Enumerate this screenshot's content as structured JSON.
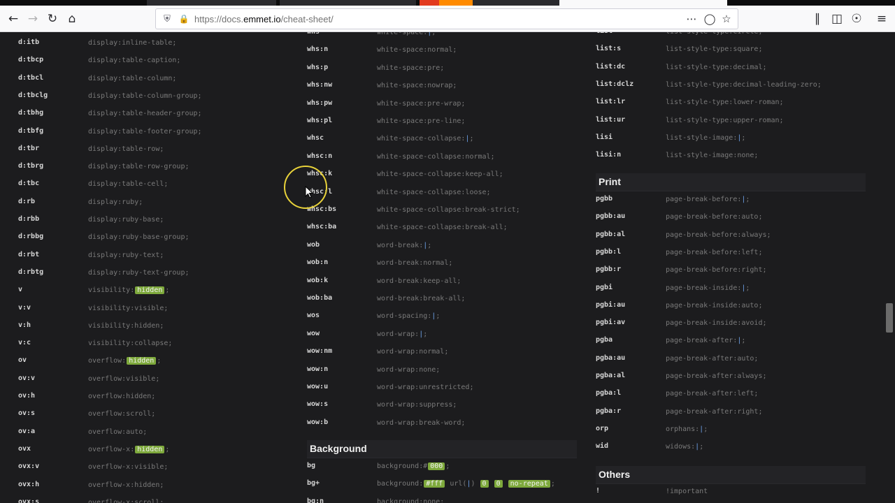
{
  "browser": {
    "url_prefix": "https://docs.",
    "url_domain": "emmet.io",
    "url_path": "/cheat-sheet/",
    "icons": [
      "back-icon",
      "forward-icon",
      "reload-icon",
      "home-icon",
      "shield-icon",
      "lock-icon",
      "more-icon",
      "pocket-icon",
      "bookmark-star-icon",
      "library-icon",
      "sidebar-icon",
      "account-icon",
      "menu-icon"
    ]
  },
  "colors": {
    "page_bg": "#1c1c1e",
    "highlight": "#7ea93c",
    "cursor_ring": "#e8d23a"
  },
  "col1": [
    {
      "abbr": "d:itb",
      "snippet": [
        {
          "t": "display:inline-table;"
        }
      ]
    },
    {
      "abbr": "d:tbcp",
      "snippet": [
        {
          "t": "display:table-caption;"
        }
      ]
    },
    {
      "abbr": "d:tbcl",
      "snippet": [
        {
          "t": "display:table-column;"
        }
      ]
    },
    {
      "abbr": "d:tbclg",
      "snippet": [
        {
          "t": "display:table-column-group;"
        }
      ]
    },
    {
      "abbr": "d:tbhg",
      "snippet": [
        {
          "t": "display:table-header-group;"
        }
      ]
    },
    {
      "abbr": "d:tbfg",
      "snippet": [
        {
          "t": "display:table-footer-group;"
        }
      ]
    },
    {
      "abbr": "d:tbr",
      "snippet": [
        {
          "t": "display:table-row;"
        }
      ]
    },
    {
      "abbr": "d:tbrg",
      "snippet": [
        {
          "t": "display:table-row-group;"
        }
      ]
    },
    {
      "abbr": "d:tbc",
      "snippet": [
        {
          "t": "display:table-cell;"
        }
      ]
    },
    {
      "abbr": "d:rb",
      "snippet": [
        {
          "t": "display:ruby;"
        }
      ]
    },
    {
      "abbr": "d:rbb",
      "snippet": [
        {
          "t": "display:ruby-base;"
        }
      ]
    },
    {
      "abbr": "d:rbbg",
      "snippet": [
        {
          "t": "display:ruby-base-group;"
        }
      ]
    },
    {
      "abbr": "d:rbt",
      "snippet": [
        {
          "t": "display:ruby-text;"
        }
      ]
    },
    {
      "abbr": "d:rbtg",
      "snippet": [
        {
          "t": "display:ruby-text-group;"
        }
      ]
    },
    {
      "abbr": "v",
      "snippet": [
        {
          "t": "visibility:"
        },
        {
          "t": "hidden",
          "hl": true
        },
        {
          "t": ";"
        }
      ]
    },
    {
      "abbr": "v:v",
      "snippet": [
        {
          "t": "visibility:visible;"
        }
      ]
    },
    {
      "abbr": "v:h",
      "snippet": [
        {
          "t": "visibility:hidden;"
        }
      ]
    },
    {
      "abbr": "v:c",
      "snippet": [
        {
          "t": "visibility:collapse;"
        }
      ]
    },
    {
      "abbr": "ov",
      "snippet": [
        {
          "t": "overflow:"
        },
        {
          "t": "hidden",
          "hl": true
        },
        {
          "t": ";"
        }
      ]
    },
    {
      "abbr": "ov:v",
      "snippet": [
        {
          "t": "overflow:visible;"
        }
      ]
    },
    {
      "abbr": "ov:h",
      "snippet": [
        {
          "t": "overflow:hidden;"
        }
      ]
    },
    {
      "abbr": "ov:s",
      "snippet": [
        {
          "t": "overflow:scroll;"
        }
      ]
    },
    {
      "abbr": "ov:a",
      "snippet": [
        {
          "t": "overflow:auto;"
        }
      ]
    },
    {
      "abbr": "ovx",
      "snippet": [
        {
          "t": "overflow-x:"
        },
        {
          "t": "hidden",
          "hl": true
        },
        {
          "t": ";"
        }
      ]
    },
    {
      "abbr": "ovx:v",
      "snippet": [
        {
          "t": "overflow-x:visible;"
        }
      ]
    },
    {
      "abbr": "ovx:h",
      "snippet": [
        {
          "t": "overflow-x:hidden;"
        }
      ]
    },
    {
      "abbr": "ovx:s",
      "snippet": [
        {
          "t": "overflow-x:scroll;"
        }
      ]
    }
  ],
  "col2": [
    {
      "abbr": "whs",
      "snippet": [
        {
          "t": "white-space:"
        },
        {
          "t": "|",
          "cur": true
        },
        {
          "t": ";"
        }
      ]
    },
    {
      "abbr": "whs:n",
      "snippet": [
        {
          "t": "white-space:normal;"
        }
      ]
    },
    {
      "abbr": "whs:p",
      "snippet": [
        {
          "t": "white-space:pre;"
        }
      ]
    },
    {
      "abbr": "whs:nw",
      "snippet": [
        {
          "t": "white-space:nowrap;"
        }
      ]
    },
    {
      "abbr": "whs:pw",
      "snippet": [
        {
          "t": "white-space:pre-wrap;"
        }
      ]
    },
    {
      "abbr": "whs:pl",
      "snippet": [
        {
          "t": "white-space:pre-line;"
        }
      ]
    },
    {
      "abbr": "whsc",
      "snippet": [
        {
          "t": "white-space-collapse:"
        },
        {
          "t": "|",
          "cur": true
        },
        {
          "t": ";"
        }
      ]
    },
    {
      "abbr": "whsc:n",
      "snippet": [
        {
          "t": "white-space-collapse:normal;"
        }
      ]
    },
    {
      "abbr": "whsc:k",
      "snippet": [
        {
          "t": "white-space-collapse:keep-all;"
        }
      ]
    },
    {
      "abbr": "whsc:l",
      "snippet": [
        {
          "t": "white-space-collapse:loose;"
        }
      ]
    },
    {
      "abbr": "whsc:bs",
      "snippet": [
        {
          "t": "white-space-collapse:break-strict;"
        }
      ]
    },
    {
      "abbr": "whsc:ba",
      "snippet": [
        {
          "t": "white-space-collapse:break-all;"
        }
      ]
    },
    {
      "abbr": "wob",
      "snippet": [
        {
          "t": "word-break:"
        },
        {
          "t": "|",
          "cur": true
        },
        {
          "t": ";"
        }
      ]
    },
    {
      "abbr": "wob:n",
      "snippet": [
        {
          "t": "word-break:normal;"
        }
      ]
    },
    {
      "abbr": "wob:k",
      "snippet": [
        {
          "t": "word-break:keep-all;"
        }
      ]
    },
    {
      "abbr": "wob:ba",
      "snippet": [
        {
          "t": "word-break:break-all;"
        }
      ]
    },
    {
      "abbr": "wos",
      "snippet": [
        {
          "t": "word-spacing:"
        },
        {
          "t": "|",
          "cur": true
        },
        {
          "t": ";"
        }
      ]
    },
    {
      "abbr": "wow",
      "snippet": [
        {
          "t": "word-wrap:"
        },
        {
          "t": "|",
          "cur": true
        },
        {
          "t": ";"
        }
      ]
    },
    {
      "abbr": "wow:nm",
      "snippet": [
        {
          "t": "word-wrap:normal;"
        }
      ]
    },
    {
      "abbr": "wow:n",
      "snippet": [
        {
          "t": "word-wrap:none;"
        }
      ]
    },
    {
      "abbr": "wow:u",
      "snippet": [
        {
          "t": "word-wrap:unrestricted;"
        }
      ]
    },
    {
      "abbr": "wow:s",
      "snippet": [
        {
          "t": "word-wrap:suppress;"
        }
      ]
    },
    {
      "abbr": "wow:b",
      "snippet": [
        {
          "t": "word-wrap:break-word;"
        }
      ]
    }
  ],
  "background": {
    "title": "Background",
    "rows": [
      {
        "abbr": "bg",
        "snippet": [
          {
            "t": "background:#"
          },
          {
            "t": "000",
            "hl": true
          },
          {
            "t": ";"
          }
        ]
      },
      {
        "abbr": "bg+",
        "snippet": [
          {
            "t": "background:"
          },
          {
            "t": "#fff",
            "hl": true
          },
          {
            "t": " url("
          },
          {
            "t": "|",
            "cur": true
          },
          {
            "t": ") "
          },
          {
            "t": "0",
            "hl": true
          },
          {
            "t": " "
          },
          {
            "t": "0",
            "hl": true
          },
          {
            "t": " "
          },
          {
            "t": "no-repeat",
            "hl": true
          },
          {
            "t": ";"
          }
        ]
      },
      {
        "abbr": "bg:n",
        "snippet": [
          {
            "t": "background:none;"
          }
        ]
      }
    ]
  },
  "col3": [
    {
      "abbr": "list",
      "snippet": [
        {
          "t": "list-style-type:circle;"
        }
      ]
    },
    {
      "abbr": "list:s",
      "snippet": [
        {
          "t": "list-style-type:square;"
        }
      ]
    },
    {
      "abbr": "list:dc",
      "snippet": [
        {
          "t": "list-style-type:decimal;"
        }
      ]
    },
    {
      "abbr": "list:dclz",
      "snippet": [
        {
          "t": "list-style-type:decimal-leading-zero;"
        }
      ]
    },
    {
      "abbr": "list:lr",
      "snippet": [
        {
          "t": "list-style-type:lower-roman;"
        }
      ]
    },
    {
      "abbr": "list:ur",
      "snippet": [
        {
          "t": "list-style-type:upper-roman;"
        }
      ]
    },
    {
      "abbr": "lisi",
      "snippet": [
        {
          "t": "list-style-image:"
        },
        {
          "t": "|",
          "cur": true
        },
        {
          "t": ";"
        }
      ]
    },
    {
      "abbr": "lisi:n",
      "snippet": [
        {
          "t": "list-style-image:none;"
        }
      ]
    }
  ],
  "print": {
    "title": "Print",
    "rows": [
      {
        "abbr": "pgbb",
        "snippet": [
          {
            "t": "page-break-before:"
          },
          {
            "t": "|",
            "cur": true
          },
          {
            "t": ";"
          }
        ]
      },
      {
        "abbr": "pgbb:au",
        "snippet": [
          {
            "t": "page-break-before:auto;"
          }
        ]
      },
      {
        "abbr": "pgbb:al",
        "snippet": [
          {
            "t": "page-break-before:always;"
          }
        ]
      },
      {
        "abbr": "pgbb:l",
        "snippet": [
          {
            "t": "page-break-before:left;"
          }
        ]
      },
      {
        "abbr": "pgbb:r",
        "snippet": [
          {
            "t": "page-break-before:right;"
          }
        ]
      },
      {
        "abbr": "pgbi",
        "snippet": [
          {
            "t": "page-break-inside:"
          },
          {
            "t": "|",
            "cur": true
          },
          {
            "t": ";"
          }
        ]
      },
      {
        "abbr": "pgbi:au",
        "snippet": [
          {
            "t": "page-break-inside:auto;"
          }
        ]
      },
      {
        "abbr": "pgbi:av",
        "snippet": [
          {
            "t": "page-break-inside:avoid;"
          }
        ]
      },
      {
        "abbr": "pgba",
        "snippet": [
          {
            "t": "page-break-after:"
          },
          {
            "t": "|",
            "cur": true
          },
          {
            "t": ";"
          }
        ]
      },
      {
        "abbr": "pgba:au",
        "snippet": [
          {
            "t": "page-break-after:auto;"
          }
        ]
      },
      {
        "abbr": "pgba:al",
        "snippet": [
          {
            "t": "page-break-after:always;"
          }
        ]
      },
      {
        "abbr": "pgba:l",
        "snippet": [
          {
            "t": "page-break-after:left;"
          }
        ]
      },
      {
        "abbr": "pgba:r",
        "snippet": [
          {
            "t": "page-break-after:right;"
          }
        ]
      },
      {
        "abbr": "orp",
        "snippet": [
          {
            "t": "orphans:"
          },
          {
            "t": "|",
            "cur": true
          },
          {
            "t": ";"
          }
        ]
      },
      {
        "abbr": "wid",
        "snippet": [
          {
            "t": "widows:"
          },
          {
            "t": "|",
            "cur": true
          },
          {
            "t": ";"
          }
        ]
      }
    ]
  },
  "others": {
    "title": "Others",
    "rows": [
      {
        "abbr": "!",
        "snippet": [
          {
            "t": "!important"
          }
        ]
      }
    ]
  }
}
